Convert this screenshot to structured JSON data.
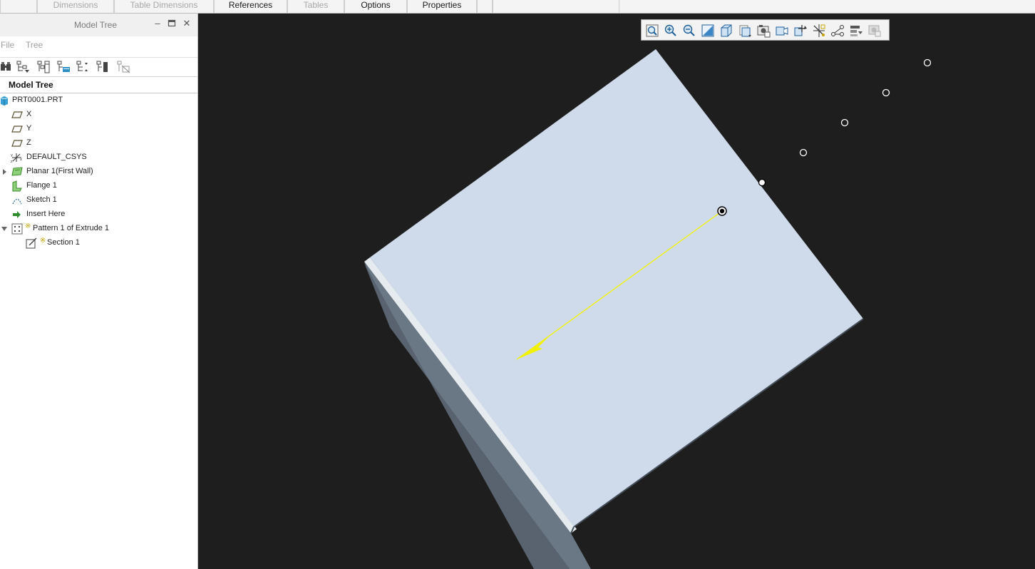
{
  "tabs": [
    {
      "label": "Dimensions",
      "state": "disabled"
    },
    {
      "label": "Table Dimensions",
      "state": "disabled"
    },
    {
      "label": "References",
      "state": "enabled"
    },
    {
      "label": "Tables",
      "state": "disabled"
    },
    {
      "label": "Options",
      "state": "enabled"
    },
    {
      "label": "Properties",
      "state": "enabled"
    }
  ],
  "panel": {
    "title": "Model Tree",
    "menus": [
      "File",
      "Tree"
    ],
    "tree_header": "Model Tree",
    "toolbar_icons": [
      "show-icon",
      "filter-settings-icon",
      "columns-icon",
      "tree-filters-icon",
      "expand-all-icon",
      "collapse-all-icon",
      "hide-icon"
    ]
  },
  "tree": {
    "items": [
      {
        "label": "PRT0001.PRT",
        "icon": "part-icon"
      },
      {
        "label": "X",
        "icon": "datum-plane-icon"
      },
      {
        "label": "Y",
        "icon": "datum-plane-icon"
      },
      {
        "label": "Z",
        "icon": "datum-plane-icon"
      },
      {
        "label": "DEFAULT_CSYS",
        "icon": "csys-icon"
      },
      {
        "label": "Planar 1(First Wall)",
        "icon": "planar-wall-icon",
        "expander": "collapsed"
      },
      {
        "label": "Flange 1",
        "icon": "flange-icon"
      },
      {
        "label": "Sketch 1",
        "icon": "sketch-icon"
      },
      {
        "label": "Insert Here",
        "icon": "insert-arrow-icon"
      },
      {
        "label": "Pattern 1 of Extrude 1",
        "icon": "pattern-icon",
        "expander": "expanded",
        "marker": "※"
      },
      {
        "label": "Section 1",
        "icon": "section-icon",
        "marker": "※"
      }
    ]
  },
  "view_toolbar": {
    "icons": [
      "refit-icon",
      "zoom-in-icon",
      "zoom-out-icon",
      "repaint-icon",
      "display-style-icon",
      "saved-orientations-icon",
      "view-manager-icon",
      "perspective-icon",
      "spin-center-icon",
      "datum-display-icon",
      "annotation-display-icon",
      "appearance-icon",
      "disabled-filter-icon"
    ]
  },
  "colors": {
    "background": "#1e1e1e",
    "sheet_face": "#cfdbea",
    "sheet_side": "#687585",
    "direction_arrow": "#f2f200",
    "panel_bg": "#ffffff",
    "toolbar_bg": "#f3f3f3"
  }
}
